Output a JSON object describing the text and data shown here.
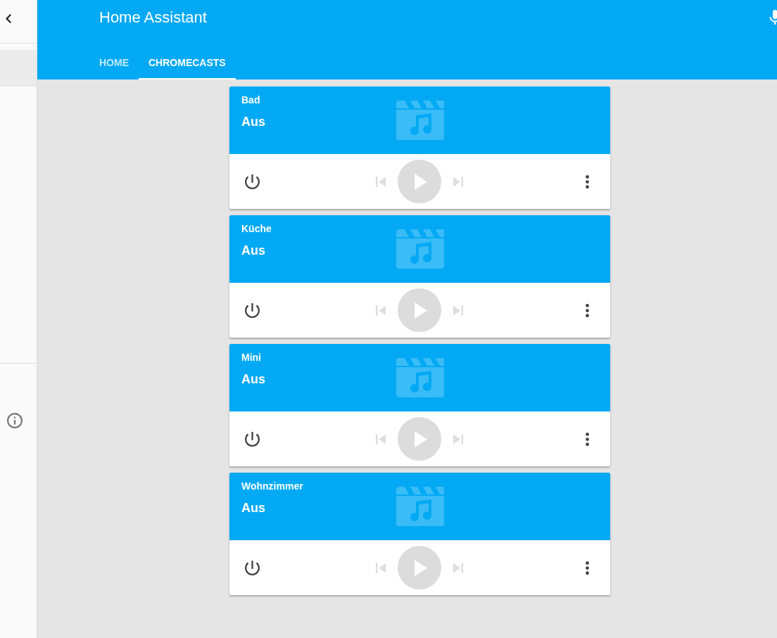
{
  "header": {
    "title": "Home Assistant"
  },
  "tabs": [
    {
      "label": "HOME",
      "selected": false
    },
    {
      "label": "CHROMECASTS",
      "selected": true
    }
  ],
  "players": [
    {
      "name": "Bad",
      "state": "Aus",
      "controls_disabled": true
    },
    {
      "name": "Küche",
      "state": "Aus",
      "controls_disabled": true
    },
    {
      "name": "Mini",
      "state": "Aus",
      "controls_disabled": true
    },
    {
      "name": "Wohnzimmer",
      "state": "Aus",
      "controls_disabled": true
    }
  ]
}
